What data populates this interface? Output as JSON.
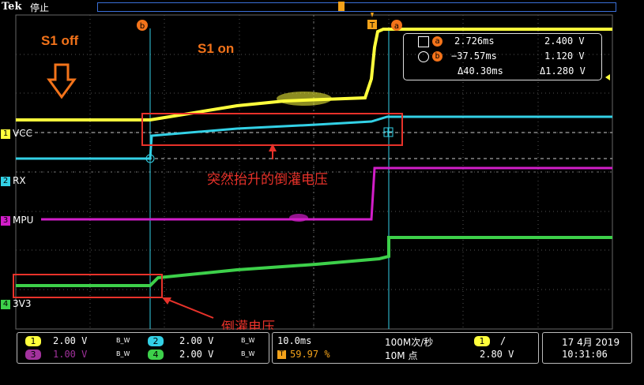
{
  "header": {
    "brand": "Tek",
    "state": "停止"
  },
  "channels": [
    {
      "id": "1",
      "label": "VCC",
      "color": "#ffff3c"
    },
    {
      "id": "2",
      "label": "RX",
      "color": "#33d1e6"
    },
    {
      "id": "3",
      "label": "MPU",
      "color": "#d21ec9"
    },
    {
      "id": "4",
      "label": "3V3",
      "color": "#3dd04a"
    }
  ],
  "cursors": {
    "a": {
      "marker": "a",
      "time": "2.726ms",
      "volt": "2.400 V"
    },
    "b": {
      "marker": "b",
      "time": "−37.57ms",
      "volt": "1.120 V"
    },
    "delta": {
      "time": "Δ40.30ms",
      "volt": "Δ1.280 V"
    }
  },
  "annotations": {
    "s1_off": "S1 off",
    "s1_on": "S1 on",
    "sudden_rise": "突然抬升的倒灌电压",
    "backflow": "倒灌电压"
  },
  "bottom": {
    "ch1": {
      "num": "1",
      "scale": "2.00 V",
      "bw": "B_W"
    },
    "ch2": {
      "num": "2",
      "scale": "2.00 V",
      "bw": "B_W"
    },
    "ch3": {
      "num": "3",
      "scale": "1.00 V",
      "bw": "B_W"
    },
    "ch4": {
      "num": "4",
      "scale": "2.00 V",
      "bw": "B_W"
    },
    "timebase": "10.0ms",
    "trigpos": "59.97 %",
    "samplerate": "100M次/秒",
    "points": "10M 点",
    "trig_ch": "1",
    "trig_slope": "/",
    "trig_level": "2.80 V",
    "date": "17 4月 2019",
    "time": "10:31:06"
  }
}
